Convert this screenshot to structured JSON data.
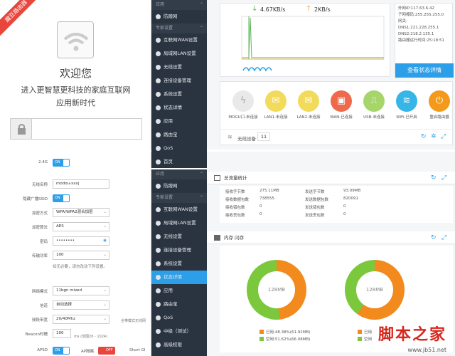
{
  "login": {
    "ribbon": "魔豆路由器",
    "welcome": "欢迎您",
    "line1": "进入更智慧更科技的家庭互联网",
    "line2": "应用新时代"
  },
  "sidebar_top": {
    "items": [
      {
        "label": "应用",
        "kind": "head"
      },
      {
        "label": "防蹭网",
        "kind": "item"
      },
      {
        "label": "专家设置",
        "kind": "head"
      },
      {
        "label": "互联网WAN设置",
        "kind": "item"
      },
      {
        "label": "局域网LAN设置",
        "kind": "item"
      },
      {
        "label": "无线设置",
        "kind": "item"
      },
      {
        "label": "连接设备管理",
        "kind": "item"
      },
      {
        "label": "系统设置",
        "kind": "item"
      },
      {
        "label": "状态详情",
        "kind": "item"
      },
      {
        "label": "应用",
        "kind": "item"
      },
      {
        "label": "路由宝",
        "kind": "item"
      },
      {
        "label": "QoS",
        "kind": "item"
      },
      {
        "label": "首页",
        "kind": "item"
      }
    ]
  },
  "sidebar_bottom": {
    "items": [
      {
        "label": "应用",
        "kind": "head"
      },
      {
        "label": "防蹭网",
        "kind": "item"
      },
      {
        "label": "专家设置",
        "kind": "head"
      },
      {
        "label": "互联网WAN设置",
        "kind": "item"
      },
      {
        "label": "局域网LAN设置",
        "kind": "item"
      },
      {
        "label": "无线设置",
        "kind": "item"
      },
      {
        "label": "连接设备管理",
        "kind": "item"
      },
      {
        "label": "系统设置",
        "kind": "item"
      },
      {
        "label": "状态详情",
        "kind": "active"
      },
      {
        "label": "应用",
        "kind": "item"
      },
      {
        "label": "路由宝",
        "kind": "item"
      },
      {
        "label": "QoS",
        "kind": "item"
      },
      {
        "label": "中级（测试）",
        "kind": "item"
      },
      {
        "label": "高级权限",
        "kind": "item"
      }
    ]
  },
  "status": {
    "down_speed": "4.67KB/s",
    "up_speed": "2KB/s",
    "info": [
      "外网IP:117.63.6.42",
      "子网掩码:255.255.255.0",
      "网关:",
      "DNS1:221.228.255.1",
      "DNS2:218.2.135.1",
      "路由器运行时间:25:18:51"
    ],
    "detail_button": "查看状态详情",
    "devices": [
      {
        "label": "MOGU口-未连接",
        "icon": "bolt-icon",
        "color": "#e9e9e9",
        "fg": "#aaaaaa"
      },
      {
        "label": "LAN1-未连接",
        "icon": "lan-icon",
        "color": "#f2da5a",
        "fg": "#ffffff"
      },
      {
        "label": "LAN2-未连接",
        "icon": "lan-icon",
        "color": "#f2da5a",
        "fg": "#ffffff"
      },
      {
        "label": "WAN-已连接",
        "icon": "wan-icon",
        "color": "#ee6a4b",
        "fg": "#ffffff"
      },
      {
        "label": "USB-未连接",
        "icon": "usb-icon",
        "color": "#a6d66a",
        "fg": "#ffffff"
      },
      {
        "label": "WiFi-已开启",
        "icon": "wifi-icon",
        "color": "#35b6e6",
        "fg": "#ffffff"
      },
      {
        "label": "重启路由器",
        "icon": "power-icon",
        "color": "#f39a1c",
        "fg": "#ffffff"
      }
    ],
    "wireless_label": "无线设备",
    "wireless_count": "11"
  },
  "wifi": {
    "band": "2.4G",
    "band_toggle": "ON",
    "rows": [
      {
        "label": "无线名称",
        "value": "modou-xxxj",
        "type": "text"
      },
      {
        "label": "隐藏广播SSID",
        "value": "ON",
        "type": "toggle"
      },
      {
        "label": "加密方式",
        "value": "WPA/WPA2混合加密",
        "type": "select"
      },
      {
        "label": "加密算法",
        "value": "AES",
        "type": "select"
      },
      {
        "label": "密码",
        "value": "••••••••",
        "type": "password"
      },
      {
        "label": "传输功率",
        "value": "100",
        "type": "select"
      }
    ],
    "note": "如无必要，请勿改动下列设置。",
    "rows2": [
      {
        "label": "网络模式",
        "value": "11bgn mixed",
        "type": "select"
      },
      {
        "label": "信道",
        "value": "自动选择",
        "type": "select"
      },
      {
        "label": "频段带宽",
        "value": "20/40Mhz",
        "type": "select"
      },
      {
        "label": "Beacon时槽",
        "value": "100",
        "type": "text"
      }
    ],
    "bandwidth_note": "全带模式无线网",
    "beacon_unit": "ms (范围20 - 1024)",
    "apsd_label": "APSD",
    "apsd_toggle": "ON",
    "ap_label": "AP隔离",
    "ap_toggle": "OFF",
    "short_gi_label": "Short GI"
  },
  "traffic": {
    "title": "总流量统计",
    "stats_left": [
      {
        "label": "接收字节数",
        "value": "275.11MB"
      },
      {
        "label": "接收数据包数",
        "value": "738555"
      },
      {
        "label": "接收错包数",
        "value": "0"
      },
      {
        "label": "接收丢包数",
        "value": "0"
      }
    ],
    "stats_right": [
      {
        "label": "发送字节数",
        "value": "93.09MB"
      },
      {
        "label": "发送数据包数",
        "value": "820091"
      },
      {
        "label": "发送错包数",
        "value": "0"
      },
      {
        "label": "发送丢包数",
        "value": "0"
      }
    ],
    "mem_title": "内存 闪存",
    "donut1": {
      "label": "128MB",
      "used_frac": 0.4838,
      "used": "已用:48.38%(61.92MB)",
      "free": "空闲:51.62%(66.08MB)"
    },
    "donut2": {
      "label": "128MB",
      "used_frac": 0.6,
      "used": "已用",
      "free": "空闲"
    },
    "used_color": "#f28a1e",
    "free_color": "#7bc83d"
  },
  "watermark": "脚本之家",
  "watermark_url": "www.jb51.net"
}
